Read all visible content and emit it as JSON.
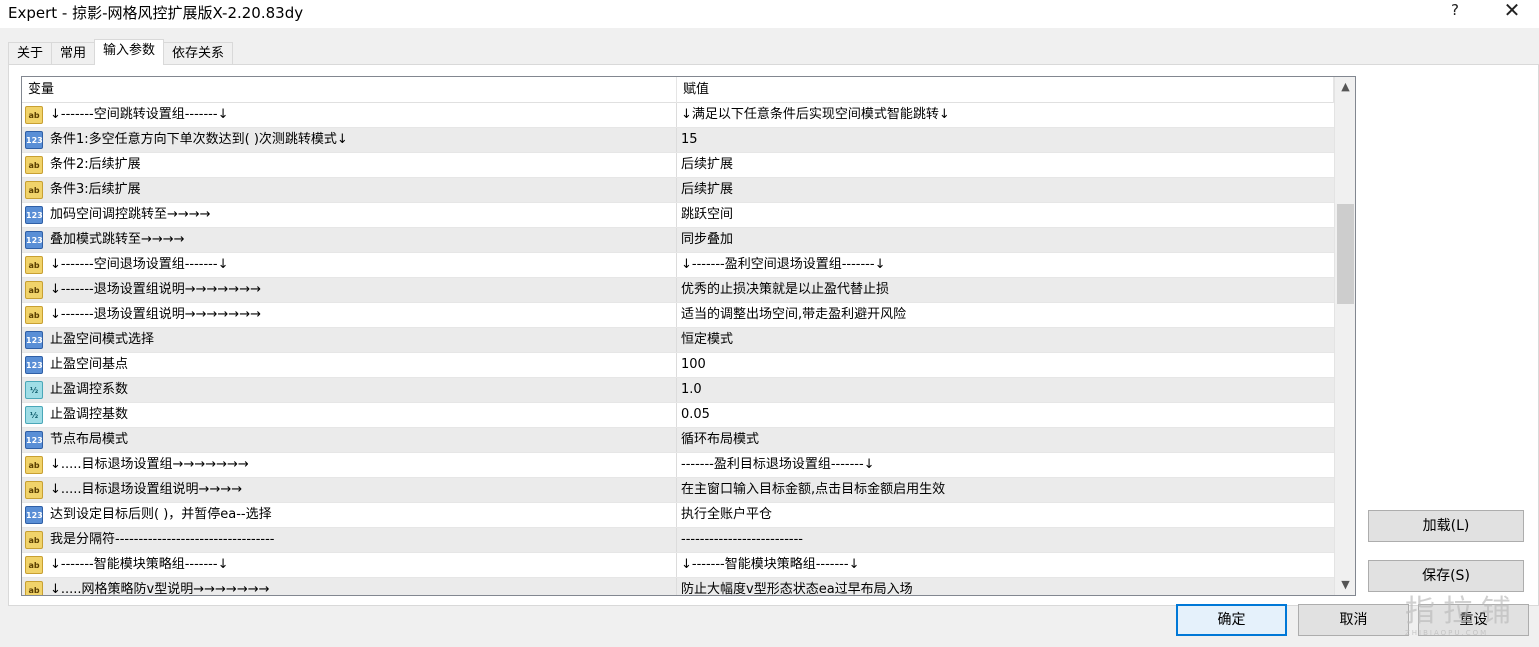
{
  "window": {
    "title": "Expert - 掠影-网格风控扩展版X-2.20.83dy",
    "help_label": "?",
    "close_label": "✕"
  },
  "tabs": [
    {
      "label": "关于",
      "active": false
    },
    {
      "label": "常用",
      "active": false
    },
    {
      "label": "输入参数",
      "active": true
    },
    {
      "label": "依存关系",
      "active": false
    }
  ],
  "grid": {
    "headers": {
      "variable": "变量",
      "value": "赋值"
    },
    "rows": [
      {
        "type": "ab",
        "type_icon": "string-type-icon",
        "variable": "↓-------空间跳转设置组-------↓",
        "value": "↓满足以下任意条件后实现空间模式智能跳转↓"
      },
      {
        "type": "123",
        "type_icon": "integer-type-icon",
        "variable": "条件1:多空任意方向下单次数达到( )次测跳转模式↓",
        "value": "15"
      },
      {
        "type": "ab",
        "type_icon": "string-type-icon",
        "variable": "条件2:后续扩展",
        "value": "后续扩展"
      },
      {
        "type": "ab",
        "type_icon": "string-type-icon",
        "variable": "条件3:后续扩展",
        "value": "后续扩展"
      },
      {
        "type": "123",
        "type_icon": "integer-type-icon",
        "variable": "加码空间调控跳转至→→→→",
        "value": "跳跃空间"
      },
      {
        "type": "123",
        "type_icon": "integer-type-icon",
        "variable": "叠加模式跳转至→→→→",
        "value": "同步叠加"
      },
      {
        "type": "ab",
        "type_icon": "string-type-icon",
        "variable": "↓-------空间退场设置组-------↓",
        "value": "↓-------盈利空间退场设置组-------↓"
      },
      {
        "type": "ab",
        "type_icon": "string-type-icon",
        "variable": "↓-------退场设置组说明→→→→→→→",
        "value": "优秀的止损决策就是以止盈代替止损"
      },
      {
        "type": "ab",
        "type_icon": "string-type-icon",
        "variable": "↓-------退场设置组说明→→→→→→→",
        "value": "适当的调整出场空间,带走盈利避开风险"
      },
      {
        "type": "123",
        "type_icon": "integer-type-icon",
        "variable": "止盈空间模式选择",
        "value": "恒定模式"
      },
      {
        "type": "123",
        "type_icon": "integer-type-icon",
        "variable": "止盈空间基点",
        "value": "100"
      },
      {
        "type": "v2",
        "type_icon": "double-type-icon",
        "variable": "止盈调控系数",
        "value": "1.0"
      },
      {
        "type": "v2",
        "type_icon": "double-type-icon",
        "variable": "止盈调控基数",
        "value": "0.05"
      },
      {
        "type": "123",
        "type_icon": "integer-type-icon",
        "variable": "节点布局模式",
        "value": "循环布局模式"
      },
      {
        "type": "ab",
        "type_icon": "string-type-icon",
        "variable": "↓.....目标退场设置组→→→→→→→",
        "value": "-------盈利目标退场设置组-------↓"
      },
      {
        "type": "ab",
        "type_icon": "string-type-icon",
        "variable": "↓.....目标退场设置组说明→→→→",
        "value": "在主窗口输入目标金额,点击目标金额启用生效"
      },
      {
        "type": "123",
        "type_icon": "integer-type-icon",
        "variable": "达到设定目标后则(      )，并暂停ea--选择",
        "value": "执行全账户平仓"
      },
      {
        "type": "ab",
        "type_icon": "string-type-icon",
        "variable": "我是分隔符----------------------------------",
        "value": "--------------------------"
      },
      {
        "type": "ab",
        "type_icon": "string-type-icon",
        "variable": "↓-------智能模块策略组-------↓",
        "value": "↓-------智能模块策略组-------↓"
      },
      {
        "type": "ab",
        "type_icon": "string-type-icon",
        "variable": "↓.....网格策略防v型说明→→→→→→→",
        "value": "防止大幅度v型形态状态ea过早布局入场"
      }
    ],
    "scroll_up_icon": "chevron-up-icon",
    "scroll_down_icon": "chevron-down-icon"
  },
  "side_buttons": {
    "load_label": "加载(L)",
    "save_label": "保存(S)"
  },
  "footer_buttons": {
    "ok_label": "确定",
    "cancel_label": "取消",
    "reset_label": "重设"
  },
  "watermark": {
    "main": "指拉铺",
    "sub": "ZHIBIAOPU.COM"
  },
  "colors": {
    "selected_border": "#0078d7",
    "row_alt": "#ebebeb"
  }
}
